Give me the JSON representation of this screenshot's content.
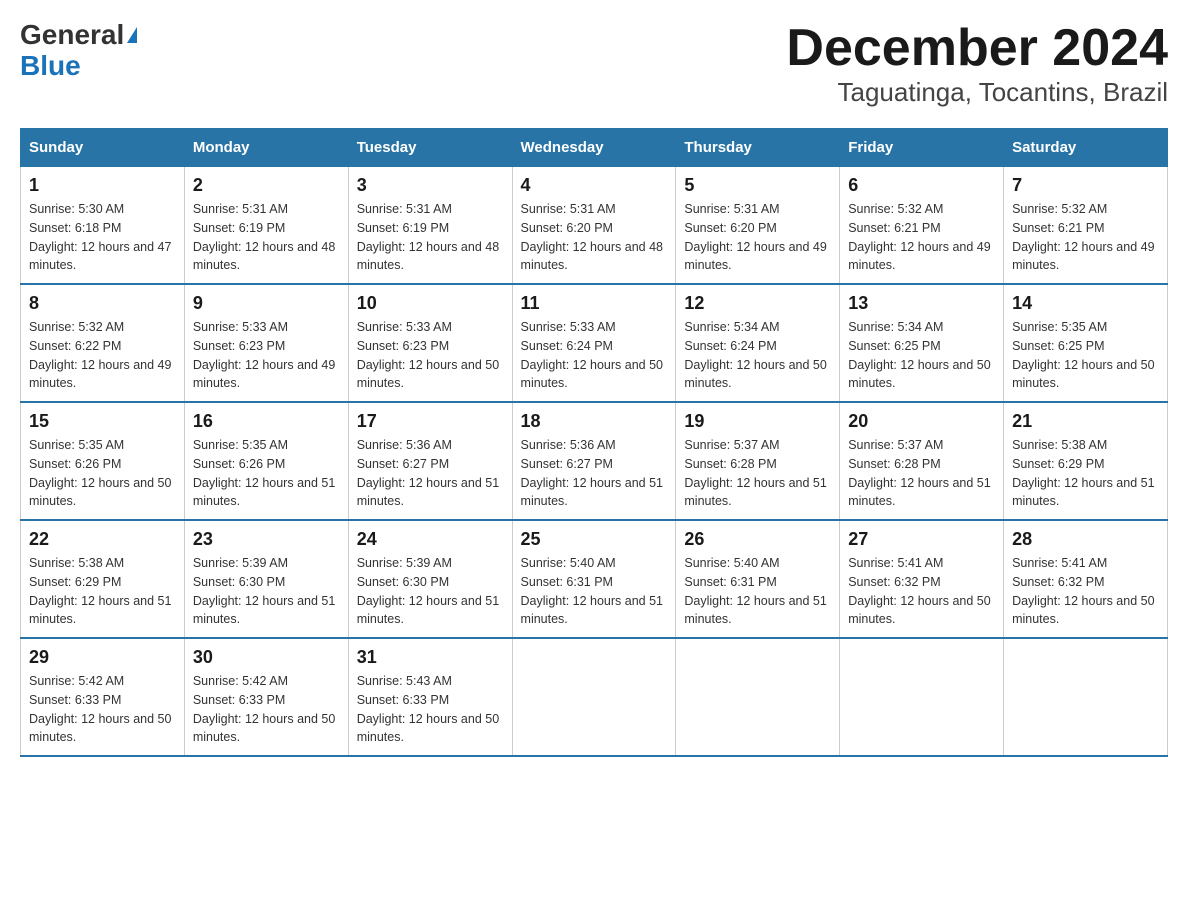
{
  "header": {
    "logo_line1": "General",
    "logo_line2": "Blue",
    "title": "December 2024",
    "subtitle": "Taguatinga, Tocantins, Brazil"
  },
  "days_of_week": [
    "Sunday",
    "Monday",
    "Tuesday",
    "Wednesday",
    "Thursday",
    "Friday",
    "Saturday"
  ],
  "weeks": [
    [
      {
        "day": "1",
        "sunrise": "5:30 AM",
        "sunset": "6:18 PM",
        "daylight": "12 hours and 47 minutes."
      },
      {
        "day": "2",
        "sunrise": "5:31 AM",
        "sunset": "6:19 PM",
        "daylight": "12 hours and 48 minutes."
      },
      {
        "day": "3",
        "sunrise": "5:31 AM",
        "sunset": "6:19 PM",
        "daylight": "12 hours and 48 minutes."
      },
      {
        "day": "4",
        "sunrise": "5:31 AM",
        "sunset": "6:20 PM",
        "daylight": "12 hours and 48 minutes."
      },
      {
        "day": "5",
        "sunrise": "5:31 AM",
        "sunset": "6:20 PM",
        "daylight": "12 hours and 49 minutes."
      },
      {
        "day": "6",
        "sunrise": "5:32 AM",
        "sunset": "6:21 PM",
        "daylight": "12 hours and 49 minutes."
      },
      {
        "day": "7",
        "sunrise": "5:32 AM",
        "sunset": "6:21 PM",
        "daylight": "12 hours and 49 minutes."
      }
    ],
    [
      {
        "day": "8",
        "sunrise": "5:32 AM",
        "sunset": "6:22 PM",
        "daylight": "12 hours and 49 minutes."
      },
      {
        "day": "9",
        "sunrise": "5:33 AM",
        "sunset": "6:23 PM",
        "daylight": "12 hours and 49 minutes."
      },
      {
        "day": "10",
        "sunrise": "5:33 AM",
        "sunset": "6:23 PM",
        "daylight": "12 hours and 50 minutes."
      },
      {
        "day": "11",
        "sunrise": "5:33 AM",
        "sunset": "6:24 PM",
        "daylight": "12 hours and 50 minutes."
      },
      {
        "day": "12",
        "sunrise": "5:34 AM",
        "sunset": "6:24 PM",
        "daylight": "12 hours and 50 minutes."
      },
      {
        "day": "13",
        "sunrise": "5:34 AM",
        "sunset": "6:25 PM",
        "daylight": "12 hours and 50 minutes."
      },
      {
        "day": "14",
        "sunrise": "5:35 AM",
        "sunset": "6:25 PM",
        "daylight": "12 hours and 50 minutes."
      }
    ],
    [
      {
        "day": "15",
        "sunrise": "5:35 AM",
        "sunset": "6:26 PM",
        "daylight": "12 hours and 50 minutes."
      },
      {
        "day": "16",
        "sunrise": "5:35 AM",
        "sunset": "6:26 PM",
        "daylight": "12 hours and 51 minutes."
      },
      {
        "day": "17",
        "sunrise": "5:36 AM",
        "sunset": "6:27 PM",
        "daylight": "12 hours and 51 minutes."
      },
      {
        "day": "18",
        "sunrise": "5:36 AM",
        "sunset": "6:27 PM",
        "daylight": "12 hours and 51 minutes."
      },
      {
        "day": "19",
        "sunrise": "5:37 AM",
        "sunset": "6:28 PM",
        "daylight": "12 hours and 51 minutes."
      },
      {
        "day": "20",
        "sunrise": "5:37 AM",
        "sunset": "6:28 PM",
        "daylight": "12 hours and 51 minutes."
      },
      {
        "day": "21",
        "sunrise": "5:38 AM",
        "sunset": "6:29 PM",
        "daylight": "12 hours and 51 minutes."
      }
    ],
    [
      {
        "day": "22",
        "sunrise": "5:38 AM",
        "sunset": "6:29 PM",
        "daylight": "12 hours and 51 minutes."
      },
      {
        "day": "23",
        "sunrise": "5:39 AM",
        "sunset": "6:30 PM",
        "daylight": "12 hours and 51 minutes."
      },
      {
        "day": "24",
        "sunrise": "5:39 AM",
        "sunset": "6:30 PM",
        "daylight": "12 hours and 51 minutes."
      },
      {
        "day": "25",
        "sunrise": "5:40 AM",
        "sunset": "6:31 PM",
        "daylight": "12 hours and 51 minutes."
      },
      {
        "day": "26",
        "sunrise": "5:40 AM",
        "sunset": "6:31 PM",
        "daylight": "12 hours and 51 minutes."
      },
      {
        "day": "27",
        "sunrise": "5:41 AM",
        "sunset": "6:32 PM",
        "daylight": "12 hours and 50 minutes."
      },
      {
        "day": "28",
        "sunrise": "5:41 AM",
        "sunset": "6:32 PM",
        "daylight": "12 hours and 50 minutes."
      }
    ],
    [
      {
        "day": "29",
        "sunrise": "5:42 AM",
        "sunset": "6:33 PM",
        "daylight": "12 hours and 50 minutes."
      },
      {
        "day": "30",
        "sunrise": "5:42 AM",
        "sunset": "6:33 PM",
        "daylight": "12 hours and 50 minutes."
      },
      {
        "day": "31",
        "sunrise": "5:43 AM",
        "sunset": "6:33 PM",
        "daylight": "12 hours and 50 minutes."
      },
      null,
      null,
      null,
      null
    ]
  ]
}
